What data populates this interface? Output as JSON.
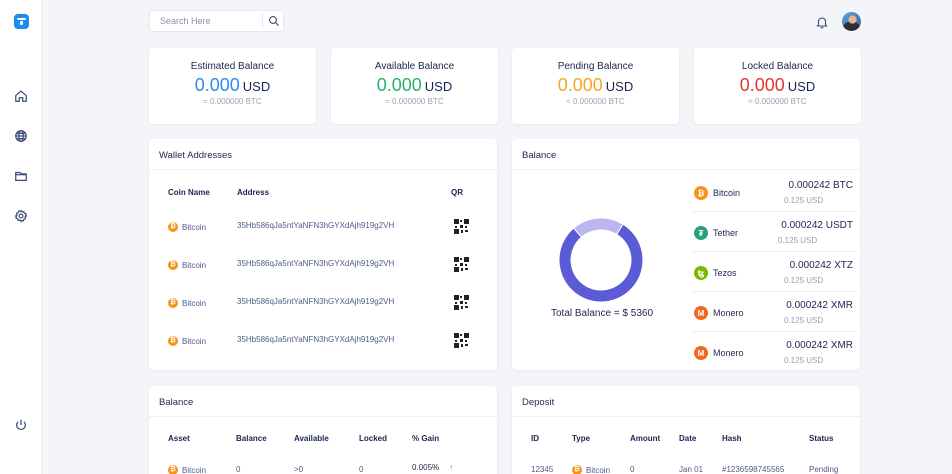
{
  "search": {
    "placeholder": "Search Here"
  },
  "stats": [
    {
      "title": "Estimated Balance",
      "value": "0.000",
      "unit": "USD",
      "btc": "≈ 0.000000 BTC",
      "color": "#2d8cf0"
    },
    {
      "title": "Available Balance",
      "value": "0.000",
      "unit": "USD",
      "btc": "≈ 0.000000 BTC",
      "color": "#27b36a"
    },
    {
      "title": "Pending Balance",
      "value": "0.000",
      "unit": "USD",
      "btc": "≈ 0.000000 BTC",
      "color": "#f5a623"
    },
    {
      "title": "Locked Balance",
      "value": "0.000",
      "unit": "USD",
      "btc": "≈ 0.000000 BTC",
      "color": "#e8352b"
    }
  ],
  "wallet": {
    "title": "Wallet Addresses",
    "columns": [
      "Coin Name",
      "Address",
      "QR"
    ],
    "rows": [
      {
        "coin": "Bitcoin",
        "address": "35Hb586qJa5ntYaNFN3hGYXdAjh919g2VH"
      },
      {
        "coin": "Bitcoin",
        "address": "35Hb586qJa5ntYaNFN3hGYXdAjh919g2VH"
      },
      {
        "coin": "Bitcoin",
        "address": "35Hb586qJa5ntYaNFN3hGYXdAjh919g2VH"
      },
      {
        "coin": "Bitcoin",
        "address": "35Hb586qJa5ntYaNFN3hGYXdAjh919g2VH"
      }
    ]
  },
  "balance_chart": {
    "title": "Balance",
    "total_label": "Total Balance = $ 5360",
    "donut": [
      {
        "name": "main",
        "fraction": 0.8,
        "color": "#5b5bd6"
      },
      {
        "name": "secondary",
        "fraction": 0.2,
        "color": "#b9b6f0"
      }
    ],
    "coins": [
      {
        "name": "Bitcoin",
        "amount": "0.000242 BTC",
        "usd": "0.125 USD",
        "icon": "bitcoin-icon",
        "color": "#f7931a",
        "glyph": "₿"
      },
      {
        "name": "Tether",
        "amount": "0.000242 USDT",
        "usd": "0.125 USD",
        "icon": "tether-icon",
        "color": "#26a17b",
        "glyph": "₮"
      },
      {
        "name": "Tezos",
        "amount": "0.000242 XTZ",
        "usd": "0.125 USD",
        "icon": "tezos-icon",
        "color": "#7ab800",
        "glyph": "ꜩ"
      },
      {
        "name": "Monero",
        "amount": "0.000242 XMR",
        "usd": "0.125 USD",
        "icon": "monero-icon",
        "color": "#f26822",
        "glyph": "M"
      },
      {
        "name": "Monero",
        "amount": "0.000242 XMR",
        "usd": "0.125 USD",
        "icon": "monero-icon",
        "color": "#f26822",
        "glyph": "M"
      }
    ]
  },
  "balance_table": {
    "title": "Balance",
    "columns": [
      "Asset",
      "Balance",
      "Available",
      "Locked",
      "% Gain"
    ],
    "row": {
      "asset": "Bitcoin",
      "balance": "0",
      "available": ">0",
      "locked": "0",
      "gain": "0.005%"
    }
  },
  "deposit": {
    "title": "Deposit",
    "columns": [
      "ID",
      "Type",
      "Amount",
      "Date",
      "Hash",
      "Status"
    ],
    "row": {
      "id": "12345",
      "type": "Bitcoin",
      "amount": "0",
      "date": "Jan 01",
      "hash": "#1236598745565",
      "status": "Pending"
    }
  }
}
